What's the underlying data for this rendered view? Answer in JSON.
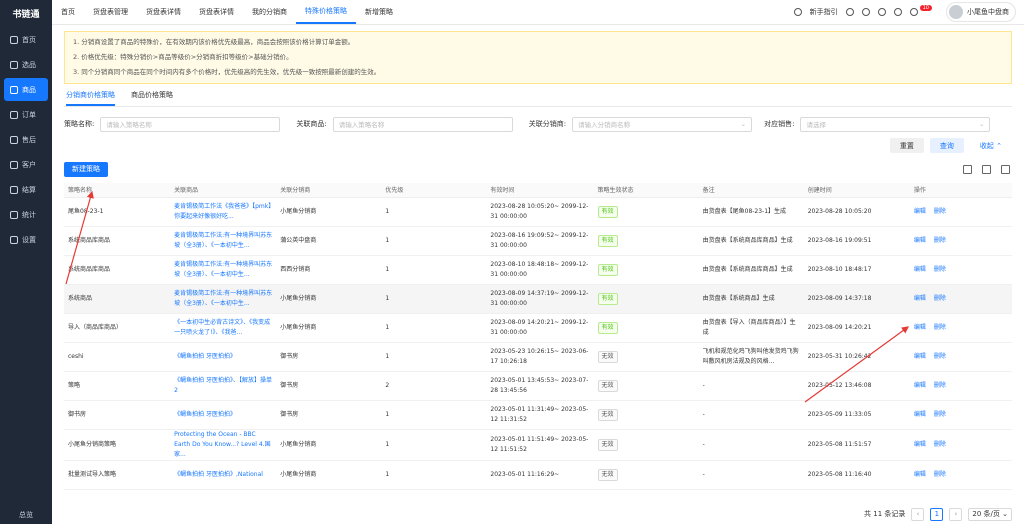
{
  "app": {
    "logo": "书链通",
    "footer": "总览"
  },
  "sidebar": {
    "items": [
      {
        "label": "首页",
        "icon": "home-icon"
      },
      {
        "label": "选品",
        "icon": "select-icon"
      },
      {
        "label": "商品",
        "icon": "goods-icon"
      },
      {
        "label": "订单",
        "icon": "order-icon"
      },
      {
        "label": "售后",
        "icon": "aftersale-icon"
      },
      {
        "label": "客户",
        "icon": "customer-icon"
      },
      {
        "label": "结算",
        "icon": "settle-icon"
      },
      {
        "label": "统计",
        "icon": "stats-icon"
      },
      {
        "label": "设置",
        "icon": "settings-icon"
      }
    ]
  },
  "topbar": {
    "tabs": [
      "首页",
      "货盘表管理",
      "货盘表详情",
      "货盘表详情",
      "我的分销商",
      "特殊价格策略",
      "新增策略"
    ],
    "guide": "新手指引",
    "badge": "10",
    "user": "小尾鱼中盘商"
  },
  "notice": [
    "1. 分销商设置了商品的特殊价，在有效期内该价格优先级最高，商品会按照该价格计算订单金额。",
    "2. 价格优先级：特殊分销价>商品等级价>分销商折扣等级价>基础分销价。",
    "3. 同个分销商同个商品在同个时间内有多个价格时，优先级高的先生效，优先级一致按照最新创建的生效。"
  ],
  "subtabs": [
    "分销商价格策略",
    "商品价格策略"
  ],
  "filters": {
    "name_label": "策略名称:",
    "name_ph": "请输入策略名称",
    "goods_label": "关联商品:",
    "goods_ph": "请输入策略名称",
    "dist_label": "关联分销商:",
    "dist_ph": "请输入分销商名称",
    "sales_label": "对应销售:",
    "sales_ph": "请选择"
  },
  "buttons": {
    "reset": "重置",
    "query": "查询",
    "collapse": "收起",
    "new": "新建策略"
  },
  "table": {
    "headers": [
      "策略名称",
      "关联商品",
      "关联分销商",
      "优先级",
      "有效时间",
      "策略生效状态",
      "备注",
      "创建时间",
      "操作"
    ],
    "rows": [
      {
        "name": "尾鱼08-23-1",
        "goods": "麦肯锡极简工作法《我爸爸》【pmk】你要起来好像很好吃...",
        "dist": "小尾鱼分销商",
        "pri": "1",
        "time": "2023-08-28 10:05:20~ 2099-12-31 00:00:00",
        "status": "有效",
        "on": true,
        "remark": "由货盘表【尾鱼08-23-1】生成",
        "created": "2023-08-28 10:05:20"
      },
      {
        "name": "系统商品库商品",
        "goods": "麦肯锡极简工作法:有一种境界叫苏东坡（全3册）、《一本初中生...",
        "dist": "蒲公英中盘商",
        "pri": "1",
        "time": "2023-08-16 19:09:52~ 2099-12-31 00:00:00",
        "status": "有效",
        "on": true,
        "remark": "由货盘表【系统商品库商品】生成",
        "created": "2023-08-16 19:09:51"
      },
      {
        "name": "系统商品库商品",
        "goods": "麦肯锡极简工作法:有一种境界叫苏东坡（全3册）、《一本初中生...",
        "dist": "西西分销商",
        "pri": "1",
        "time": "2023-08-10 18:48:18~ 2099-12-31 00:00:00",
        "status": "有效",
        "on": true,
        "remark": "由货盘表【系统商品库商品】生成",
        "created": "2023-08-10 18:48:17"
      },
      {
        "name": "系统商品",
        "goods": "麦肯锡极简工作法:有一种境界叫苏东坡（全3册）、《一本初中生...",
        "dist": "小尾鱼分销商",
        "pri": "1",
        "time": "2023-08-09 14:37:19~ 2099-12-31 00:00:00",
        "status": "有效",
        "on": true,
        "remark": "由货盘表【系统商品】生成",
        "created": "2023-08-09 14:37:18"
      },
      {
        "name": "导入（商品库商品）",
        "goods": "《一本初中生必背古诗文》、《我变成一只喷火龙了!》、《我爸...",
        "dist": "小尾鱼分销商",
        "pri": "1",
        "time": "2023-08-09 14:20:21~ 2099-12-31 00:00:00",
        "status": "有效",
        "on": true,
        "remark": "由货盘表【导入（商品库商品）】生成",
        "created": "2023-08-09 14:20:21"
      },
      {
        "name": "ceshi",
        "goods": "《鲷鱼拍拍 牙医拍拍》",
        "dist": "御书房",
        "pri": "1",
        "time": "2023-05-23 10:26:15~ 2023-06-17 10:26:18",
        "status": "无效",
        "on": false,
        "remark": "飞机和规范化鸡飞狗叫他发货鸡飞狗叫敷风机房法规及的风格...",
        "created": "2023-05-31 10:26:42"
      },
      {
        "name": "策略",
        "goods": "《鲷鱼拍拍 牙医拍拍》、【解放】操单2",
        "dist": "御书房",
        "pri": "2",
        "time": "2023-05-01 13:45:53~ 2023-07-28 13:45:56",
        "status": "无效",
        "on": false,
        "remark": "-",
        "created": "2023-05-12 13:46:08"
      },
      {
        "name": "御书房",
        "goods": "《鲷鱼拍拍 牙医拍拍》",
        "dist": "御书房",
        "pri": "1",
        "time": "2023-05-01 11:31:49~ 2023-05-12 11:31:52",
        "status": "无效",
        "on": false,
        "remark": "-",
        "created": "2023-05-09 11:33:05"
      },
      {
        "name": "小尾鱼分销商策略",
        "goods": "Protecting the Ocean - BBC Earth Do You Know...? Level 4.国家...",
        "dist": "小尾鱼分销商",
        "pri": "1",
        "time": "2023-05-01 11:51:49~ 2023-05-12 11:51:52",
        "status": "无效",
        "on": false,
        "remark": "-",
        "created": "2023-05-08 11:51:57"
      },
      {
        "name": "批量测试导入策略",
        "goods": "《鲷鱼拍拍 牙医拍拍》,National",
        "dist": "小尾鱼分销商",
        "pri": "1",
        "time": "2023-05-01 11:16:29~",
        "status": "无效",
        "on": false,
        "remark": "-",
        "created": "2023-05-08 11:16:40"
      }
    ],
    "ops": [
      "编辑",
      "删除"
    ]
  },
  "pager": {
    "total": "共 11 条记录",
    "page": "1",
    "size": "20 条/页"
  }
}
